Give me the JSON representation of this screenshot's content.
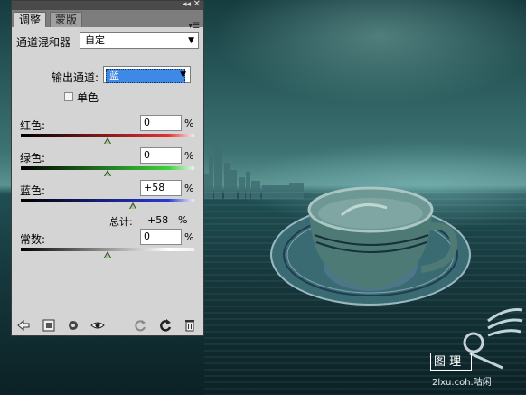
{
  "panel": {
    "tabs": [
      {
        "label": "调整"
      },
      {
        "label": "蒙版"
      }
    ],
    "preset_label": "通道混和器",
    "preset_value": "自定",
    "output_channel_label": "输出通道:",
    "output_channel_value": "蓝",
    "monochrome_label": "单色",
    "monochrome_checked": false,
    "sliders": [
      {
        "label": "红色:",
        "value": "0",
        "unit": "%",
        "percent": 0,
        "gradient": [
          "#000000",
          "#e53030"
        ]
      },
      {
        "label": "绿色:",
        "value": "0",
        "unit": "%",
        "percent": 0,
        "gradient": [
          "#000000",
          "#3ad23a"
        ]
      },
      {
        "label": "蓝色:",
        "value": "+58",
        "unit": "%",
        "percent": 58,
        "gradient": [
          "#000000",
          "#2a3ad8"
        ]
      }
    ],
    "total_label": "总计:",
    "total_value": "+58",
    "total_unit": "%",
    "constant": {
      "label": "常数:",
      "value": "0",
      "unit": "%",
      "percent": 0,
      "gradient": [
        "#000000",
        "#ffffff"
      ]
    },
    "bottom_icons": [
      "back-arrow-icon",
      "clip-to-layer-icon",
      "view-previous-icon",
      "visibility-eye-icon",
      "reset-icon",
      "refresh-icon",
      "trash-icon"
    ]
  },
  "watermark": {
    "box_text": "图 理",
    "url_text": "2lxu.coh.咕闲"
  },
  "colors": {
    "panel_bg": "#d4d4d4",
    "selection_blue": "#3e88e6",
    "sea_teal": "#2a5a5b"
  }
}
